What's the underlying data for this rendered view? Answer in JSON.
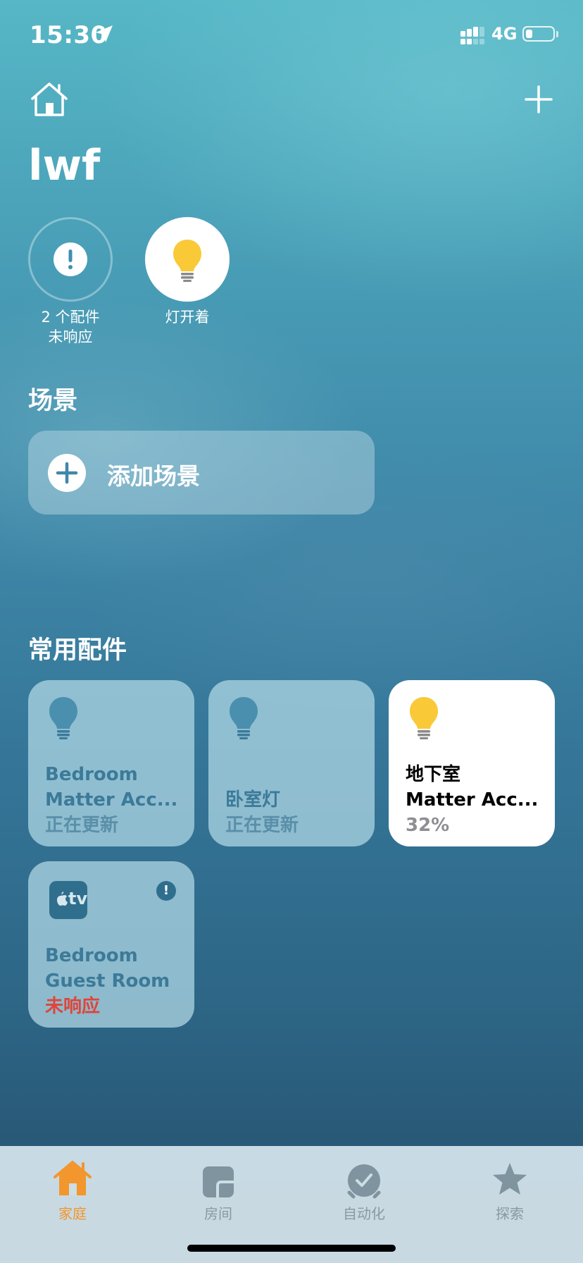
{
  "status_bar": {
    "time": "15:30",
    "network": "4G",
    "battery_level": 0.25
  },
  "header": {
    "home_name": "lwf"
  },
  "status_items": [
    {
      "label_line1": "2 个配件",
      "label_line2": "未响应",
      "icon": "exclamation-icon"
    },
    {
      "label": "灯开着",
      "icon": "lightbulb-icon"
    }
  ],
  "scenes": {
    "title": "场景",
    "add_label": "添加场景"
  },
  "favorites": {
    "title": "常用配件",
    "tiles": [
      {
        "name_line1": "Bedroom",
        "name_line2": "Matter Acc...",
        "status": "正在更新",
        "icon": "lightbulb-icon",
        "state": "off"
      },
      {
        "name_line1": "",
        "name_line2": "卧室灯",
        "status": "正在更新",
        "icon": "lightbulb-icon",
        "state": "off"
      },
      {
        "name_line1": "地下室",
        "name_line2": "Matter Acc...",
        "status": "32%",
        "icon": "lightbulb-icon",
        "state": "on"
      },
      {
        "name_line1": "Bedroom",
        "name_line2": "Guest Room",
        "status": "未响应",
        "icon": "apple-tv-icon",
        "state": "error",
        "badge_text": "tv",
        "alert_badge": "!"
      }
    ]
  },
  "tab_bar": {
    "tabs": [
      {
        "label": "家庭",
        "icon": "house-icon",
        "active": true
      },
      {
        "label": "房间",
        "icon": "room-icon",
        "active": false
      },
      {
        "label": "自动化",
        "icon": "automation-icon",
        "active": false
      },
      {
        "label": "探索",
        "icon": "star-icon",
        "active": false
      }
    ]
  },
  "colors": {
    "accent": "#f2962d",
    "bulb_yellow": "#f9c938",
    "error_red": "#e0443a"
  }
}
